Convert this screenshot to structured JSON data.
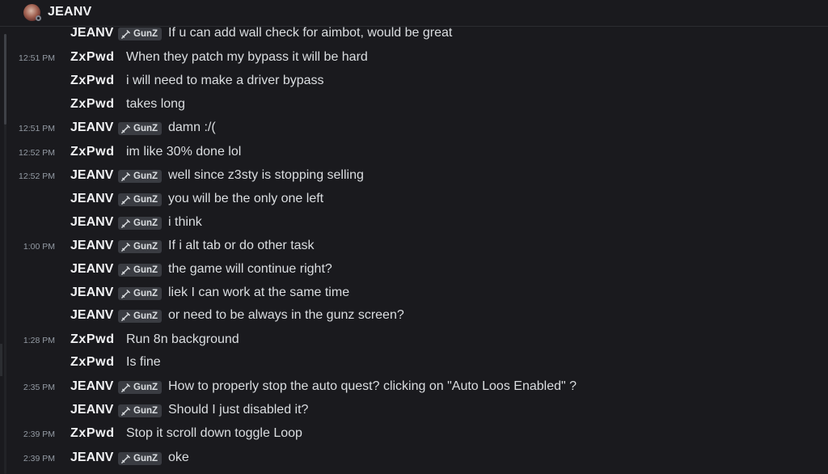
{
  "channel": {
    "title": "JEANV",
    "avatar_icon": "user-avatar",
    "status": "offline"
  },
  "messages": [
    {
      "time": "",
      "author": "JEANV",
      "tag": "GunZ",
      "text": "If u can add wall check for aimbot, would be great"
    },
    {
      "time": "12:51 PM",
      "author": "ZxPwd",
      "tag": "",
      "text": "When they patch my bypass it will be hard"
    },
    {
      "time": "",
      "author": "ZxPwd",
      "tag": "",
      "text": "i will need to make a driver bypass"
    },
    {
      "time": "",
      "author": "ZxPwd",
      "tag": "",
      "text": "takes long"
    },
    {
      "time": "12:51 PM",
      "author": "JEANV",
      "tag": "GunZ",
      "text": "damn :/("
    },
    {
      "time": "12:52 PM",
      "author": "ZxPwd",
      "tag": "",
      "text": "im like 30% done lol"
    },
    {
      "time": "12:52 PM",
      "author": "JEANV",
      "tag": "GunZ",
      "text": "well since z3sty is stopping selling"
    },
    {
      "time": "",
      "author": "JEANV",
      "tag": "GunZ",
      "text": "you will be the only one left"
    },
    {
      "time": "",
      "author": "JEANV",
      "tag": "GunZ",
      "text": "i think"
    },
    {
      "time": "1:00 PM",
      "author": "JEANV",
      "tag": "GunZ",
      "text": "If i alt tab or do other task"
    },
    {
      "time": "",
      "author": "JEANV",
      "tag": "GunZ",
      "text": "the game will continue right?"
    },
    {
      "time": "",
      "author": "JEANV",
      "tag": "GunZ",
      "text": "liek I can work at the same time"
    },
    {
      "time": "",
      "author": "JEANV",
      "tag": "GunZ",
      "text": "or need to be always in the gunz screen?"
    },
    {
      "time": "1:28 PM",
      "author": "ZxPwd",
      "tag": "",
      "text": "Run 8n background"
    },
    {
      "time": "",
      "author": "ZxPwd",
      "tag": "",
      "text": "Is fine"
    },
    {
      "time": "2:35 PM",
      "author": "JEANV",
      "tag": "GunZ",
      "text": "How to properly stop the auto quest? clicking on \"Auto Loos Enabled\" ?"
    },
    {
      "time": "",
      "author": "JEANV",
      "tag": "GunZ",
      "text": "Should I just disabled it?"
    },
    {
      "time": "2:39 PM",
      "author": "ZxPwd",
      "tag": "",
      "text": "Stop it scroll down toggle Loop"
    },
    {
      "time": "2:39 PM",
      "author": "JEANV",
      "tag": "GunZ",
      "text": "oke"
    }
  ]
}
